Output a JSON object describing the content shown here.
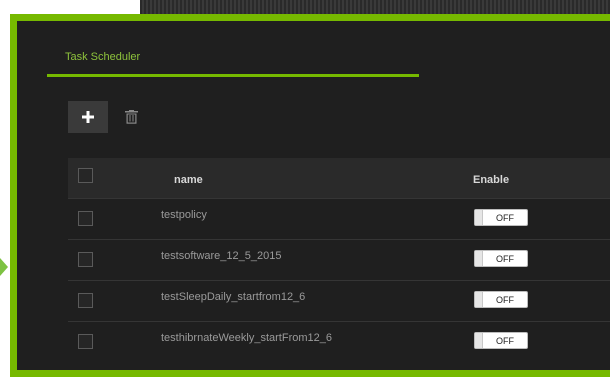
{
  "header": {
    "title": "Task Scheduler"
  },
  "toolbar": {
    "add_icon": "plus-icon",
    "delete_icon": "trash-icon"
  },
  "table": {
    "columns": {
      "name": "name",
      "enable": "Enable"
    },
    "rows": [
      {
        "name": "testpolicy",
        "enable": "OFF"
      },
      {
        "name": "testsoftware_12_5_2015",
        "enable": "OFF"
      },
      {
        "name": "testSleepDaily_startfrom12_6",
        "enable": "OFF"
      },
      {
        "name": "testhibrnateWeekly_startFrom12_6",
        "enable": "OFF"
      }
    ]
  },
  "colors": {
    "accent": "#76b900",
    "panel": "#1f1f1f",
    "header_row": "#2a2a2a"
  }
}
